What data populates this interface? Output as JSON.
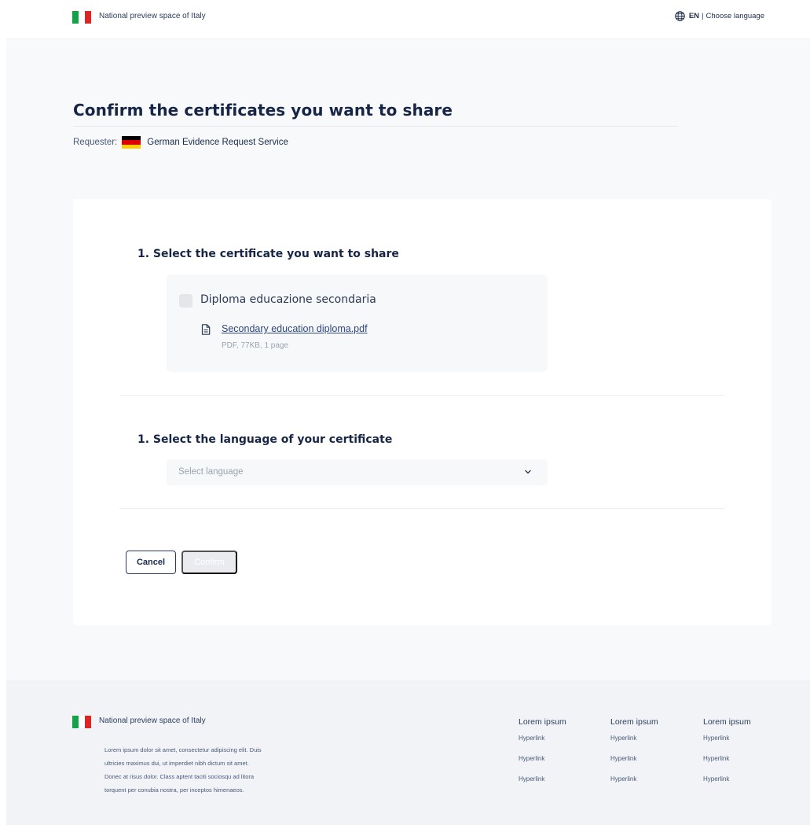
{
  "header": {
    "site_title": "National preview space of Italy",
    "language_code": "EN",
    "language_separator": "|",
    "language_action": "Choose language"
  },
  "page": {
    "title": "Confirm the certificates you want to share",
    "requester_label": "Requester:",
    "requester_name": "German Evidence Request Service"
  },
  "step1": {
    "title": "1. Select the certificate you want to share",
    "certificate_name": "Diploma educazione secondaria",
    "file_name": "Secondary education diploma.pdf",
    "file_meta": "PDF, 77KB, 1 page",
    "checked": false
  },
  "step2": {
    "title": "1. Select the language of your certificate",
    "select_placeholder": "Select language"
  },
  "actions": {
    "cancel_label": "Cancel",
    "confirm_label": "Confirm"
  },
  "footer": {
    "site_title": "National preview space of Italy",
    "description": "Lorem ipsum dolor sit amet, consectetur adipiscing elit. Duis ultricies maximus dui, ut imperdiet nibh dictum sit amet. Donec at risus dolor. Class aptent taciti sociosqu ad litora torquent per conubia nostra, per inceptos himenaeos.",
    "columns": [
      {
        "heading": "Lorem ipsum",
        "links": [
          "Hyperlink",
          "Hyperlink",
          "Hyperlink"
        ]
      },
      {
        "heading": "Lorem ipsum",
        "links": [
          "Hyperlink",
          "Hyperlink",
          "Hyperlink"
        ]
      },
      {
        "heading": "Lorem ipsum",
        "links": [
          "Hyperlink",
          "Hyperlink",
          "Hyperlink"
        ]
      }
    ]
  },
  "colors": {
    "flag_it": [
      "#15a34a",
      "#ffffff",
      "#dc2626"
    ],
    "flag_de": [
      "#000000",
      "#dd0000",
      "#ffce00"
    ],
    "primary_text": "#172647",
    "link": "#2e4780",
    "disabled_button": "#e9ebef"
  },
  "icons": {
    "language": "globe-icon",
    "file": "document-icon",
    "select": "chevron-down-icon"
  }
}
